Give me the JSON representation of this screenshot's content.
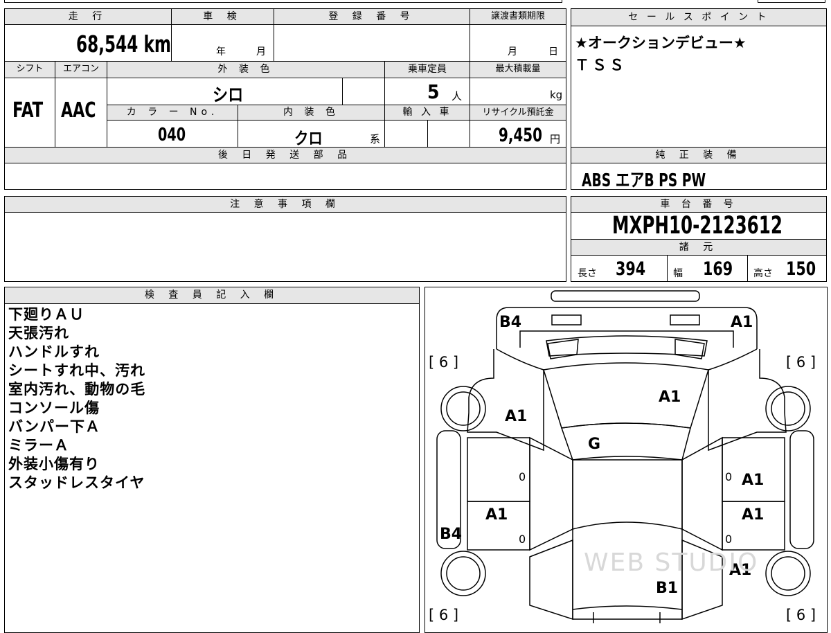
{
  "top_sheet": {
    "mileage_label": "走 行",
    "mileage": "68,544",
    "mileage_unit": "km",
    "inspection_label": "車 検",
    "year_label": "年",
    "month_label": "月",
    "registration_label": "登 録 番 号",
    "transfer_deadline_label": "譲渡書類期限",
    "deadline_month": "月",
    "deadline_day": "日",
    "shift_label": "シフト",
    "shift": "FAT",
    "aircon_label": "エアコン",
    "aircon": "AAC",
    "exterior_color_label": "外 装 色",
    "exterior_color": "シロ",
    "capacity_label": "乗車定員",
    "capacity": "5",
    "capacity_unit": "人",
    "max_load_label": "最大積載量",
    "max_load_unit": "kg",
    "color_no_label": "カ ラ ー No.",
    "color_no": "040",
    "interior_color_label": "内 装 色",
    "interior_color": "クロ",
    "interior_suffix": "系",
    "import_label": "輸 入 車",
    "recycle_label": "リサイクル預託金",
    "recycle_fee": "9,450",
    "recycle_unit": "円",
    "later_parts_label": "後 日 発 送 部 品"
  },
  "sales_point": {
    "label": "セ ー ル ス ポ イ ン ト",
    "lines": [
      "★オークションデビュー★",
      "ＴＳＳ"
    ]
  },
  "equipment": {
    "label": "純 正 装 備",
    "items": "ABS エアB PS PW"
  },
  "caution": {
    "label": "注 意 事 項 欄"
  },
  "chassis": {
    "label": "車 台 番 号",
    "number": "MXPH10-2123612",
    "spec_label": "諸 元",
    "length_label": "長さ",
    "length": "394",
    "width_label": "幅",
    "width": "169",
    "height_label": "高さ",
    "height": "150"
  },
  "inspector": {
    "label": "検 査 員 記 入 欄",
    "notes": [
      "下廻りＡＵ",
      "天張汚れ",
      "ハンドルすれ",
      "シートすれ中、汚れ",
      "室内汚れ、動物の毛",
      "コンソール傷",
      "バンパー下Ａ",
      "ミラーＡ",
      "外装小傷有り",
      "スタッドレスタイヤ"
    ]
  },
  "damage_map": {
    "tire_marks": [
      "[ 6 ]",
      "[ 6 ]",
      "[ 6 ]",
      "[ 6 ]"
    ],
    "codes": {
      "front_left": "B4",
      "front_right": "A1",
      "hood": "A1",
      "front_left_fender": "A1",
      "windshield": "G",
      "right_front_door": "A1",
      "left_rear_door": "A1",
      "right_rear_door": "A1",
      "left_rear": "B4",
      "right_rear_fender": "A1",
      "rear": "B1"
    },
    "zeros": [
      "0",
      "0",
      "0",
      "0"
    ],
    "watermark": "WEB STUDIO"
  }
}
